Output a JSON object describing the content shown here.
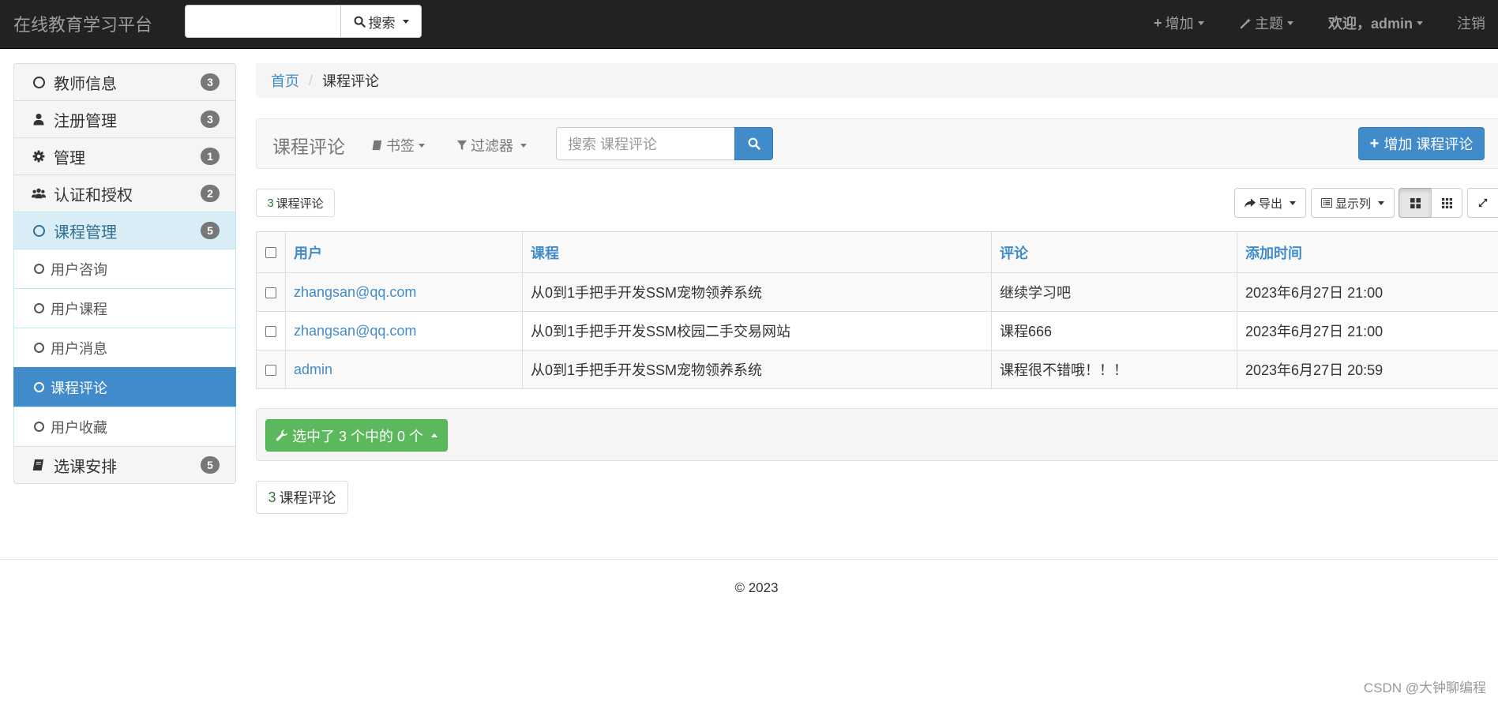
{
  "navbar": {
    "brand": "在线教育学习平台",
    "search_button": "搜索",
    "add_label": "增加",
    "theme_label": "主题",
    "welcome_label": "欢迎，admin",
    "logout_label": "注销"
  },
  "sidebar": {
    "items": [
      {
        "label": "教师信息",
        "badge": "3",
        "icon": "circle-o-icon"
      },
      {
        "label": "注册管理",
        "badge": "3",
        "icon": "user-icon"
      },
      {
        "label": "管理",
        "badge": "1",
        "icon": "gear-icon"
      },
      {
        "label": "认证和授权",
        "badge": "2",
        "icon": "users-icon"
      },
      {
        "label": "课程管理",
        "badge": "5",
        "icon": "circle-o-icon",
        "expanded": true
      }
    ],
    "subitems": [
      {
        "label": "用户咨询"
      },
      {
        "label": "用户课程"
      },
      {
        "label": "用户消息"
      },
      {
        "label": "课程评论",
        "selected": true
      },
      {
        "label": "用户收藏"
      }
    ],
    "last_item": {
      "label": "选课安排",
      "badge": "5",
      "icon": "book-icon"
    }
  },
  "breadcrumb": {
    "home": "首页",
    "current": "课程评论"
  },
  "toolbar": {
    "title": "课程评论",
    "bookmarks_label": "书签",
    "filter_label": "过滤器",
    "search_placeholder": "搜索 课程评论",
    "add_button": "增加 课程评论"
  },
  "result_count": {
    "num": "3",
    "label": "课程评论"
  },
  "tools": {
    "export_label": "导出",
    "columns_label": "显示列"
  },
  "table": {
    "headers": [
      "用户",
      "课程",
      "评论",
      "添加时间"
    ],
    "rows": [
      {
        "user": "zhangsan@qq.com",
        "course": "从0到1手把手开发SSM宠物领养系统",
        "comment": "继续学习吧",
        "time": "2023年6月27日 21:00"
      },
      {
        "user": "zhangsan@qq.com",
        "course": "从0到1手把手开发SSM校园二手交易网站",
        "comment": "课程666",
        "time": "2023年6月27日 21:00"
      },
      {
        "user": "admin",
        "course": "从0到1手把手开发SSM宠物领养系统",
        "comment": "课程很不错哦！！！",
        "time": "2023年6月27日 20:59"
      }
    ]
  },
  "action_bar": {
    "selected_label": "选中了 3 个中的 0 个"
  },
  "footer": {
    "copyright": "© 2023"
  },
  "watermark": "CSDN @大钟聊编程",
  "colors": {
    "navbar_bg": "#222222",
    "primary": "#428bca",
    "success": "#5cb85c",
    "badge": "#777777"
  }
}
